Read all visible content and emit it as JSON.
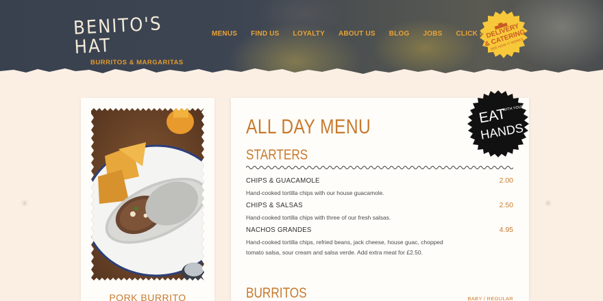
{
  "brand": {
    "name": "BENITO'S HAT",
    "tagline": "BURRITOS & MARGARITAS"
  },
  "nav": {
    "items": [
      "MENUS",
      "FIND US",
      "LOYALTY",
      "ABOUT US",
      "BLOG",
      "JOBS",
      "CLICK & COLLECT"
    ]
  },
  "delivery_badge": {
    "line1": "DELIVERY",
    "line2": "& CATERING",
    "small": "SEE HOW IT WORKS",
    "icon": "truck-icon"
  },
  "feature": {
    "label": "PORK BURRITO"
  },
  "menu": {
    "title": "ALL DAY MENU",
    "badge": {
      "big1": "EAT",
      "small": "WITH YOUR",
      "big2": "HANDS"
    },
    "sections": [
      {
        "title": "STARTERS",
        "items": [
          {
            "name": "CHIPS & GUACAMOLE",
            "price": "2.00",
            "desc": "Hand-cooked tortilla chips with our house guacamole."
          },
          {
            "name": "CHIPS & SALSAS",
            "price": "2.50",
            "desc": "Hand-cooked tortilla chips with three of our fresh salsas."
          },
          {
            "name": "NACHOS GRANDES",
            "price": "4.95",
            "desc_line1": "Hand-cooked tortilla chips, refried beans, jack cheese, house guac, chopped",
            "desc_line2": "tomato salsa, sour cream and salsa verde. Add extra meat for £2.50."
          }
        ]
      },
      {
        "title": "BURRITOS",
        "note": "BABY / REGULAR"
      }
    ]
  },
  "colors": {
    "accent": "#c77a2d",
    "nav": "#e8a236",
    "page_bg": "#fbefe4",
    "badge_yellow": "#f7c93a"
  }
}
